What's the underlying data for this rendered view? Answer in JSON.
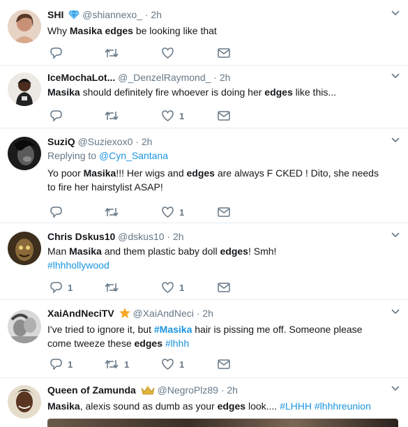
{
  "tweets": [
    {
      "name": "SHI",
      "handle": "@shiannexo_",
      "time": "· 2h",
      "badge": "diamond",
      "segments": [
        {
          "t": "Why ",
          "b": false
        },
        {
          "t": "Masika",
          "b": true
        },
        {
          "t": " ",
          "b": false
        },
        {
          "t": "edges",
          "b": true
        },
        {
          "t": " be looking like that",
          "b": false
        }
      ],
      "counts": {
        "reply": "",
        "retweet": "",
        "like": ""
      }
    },
    {
      "name": "IceMochaLot...",
      "handle": "@_DenzelRaymond_",
      "time": "· 2h",
      "segments": [
        {
          "t": "Masika",
          "b": true
        },
        {
          "t": " should definitely fire whoever is doing her ",
          "b": false
        },
        {
          "t": "edges",
          "b": true
        },
        {
          "t": " like this...",
          "b": false
        }
      ],
      "counts": {
        "reply": "",
        "retweet": "",
        "like": "1"
      }
    },
    {
      "name": "SuziQ",
      "handle": "@Suziexox0",
      "time": "· 2h",
      "replying_label": "Replying to",
      "replying_to": "@Cyn_Santana",
      "segments": [
        {
          "t": "Yo poor ",
          "b": false
        },
        {
          "t": "Masika",
          "b": true
        },
        {
          "t": "!!! Her wigs and ",
          "b": false
        },
        {
          "t": "edges",
          "b": true
        },
        {
          "t": " are always F   CKED ! Dito, she needs to fire her hairstylist ASAP!",
          "b": false
        }
      ],
      "counts": {
        "reply": "",
        "retweet": "",
        "like": "1"
      }
    },
    {
      "name": "Chris Dskus10",
      "handle": "@dskus10",
      "time": "· 2h",
      "segments": [
        {
          "t": "Man ",
          "b": false
        },
        {
          "t": "Masika",
          "b": true
        },
        {
          "t": " and them plastic baby doll ",
          "b": false
        },
        {
          "t": "edges",
          "b": true
        },
        {
          "t": "! Smh!",
          "b": false
        }
      ],
      "hashtags_line": "#lhhhollywood",
      "counts": {
        "reply": "1",
        "retweet": "",
        "like": "1"
      }
    },
    {
      "name": "XaiAndNeciTV",
      "handle": "@XaiAndNeci",
      "time": "· 2h",
      "badge": "star",
      "segments": [
        {
          "t": "I've tried to ignore it, but ",
          "b": false
        },
        {
          "t": "#Masika",
          "b": true,
          "tag": true
        },
        {
          "t": " hair is pissing me off. Someone please come tweeze these ",
          "b": false
        },
        {
          "t": "edges",
          "b": true
        },
        {
          "t": " ",
          "b": false
        },
        {
          "t": "#lhhh",
          "b": false,
          "tag": true
        }
      ],
      "counts": {
        "reply": "1",
        "retweet": "1",
        "like": "1"
      }
    },
    {
      "name": "Queen of Zamunda",
      "handle": "@NegroPlz89",
      "time": "· 2h",
      "badge": "crown",
      "segments": [
        {
          "t": "Masika",
          "b": true
        },
        {
          "t": ", alexis sound as dumb as your ",
          "b": false
        },
        {
          "t": "edges",
          "b": true
        },
        {
          "t": " look.... ",
          "b": false
        },
        {
          "t": "#LHHH",
          "b": false,
          "tag": true
        },
        {
          "t": " ",
          "b": false
        },
        {
          "t": "#lhhhreunion",
          "b": false,
          "tag": true
        }
      ],
      "counts": {
        "reply": "",
        "retweet": "",
        "like": ""
      }
    }
  ],
  "colors": {
    "accent": "#1b95e0",
    "muted": "#657786",
    "divider": "#e6ecf0"
  }
}
